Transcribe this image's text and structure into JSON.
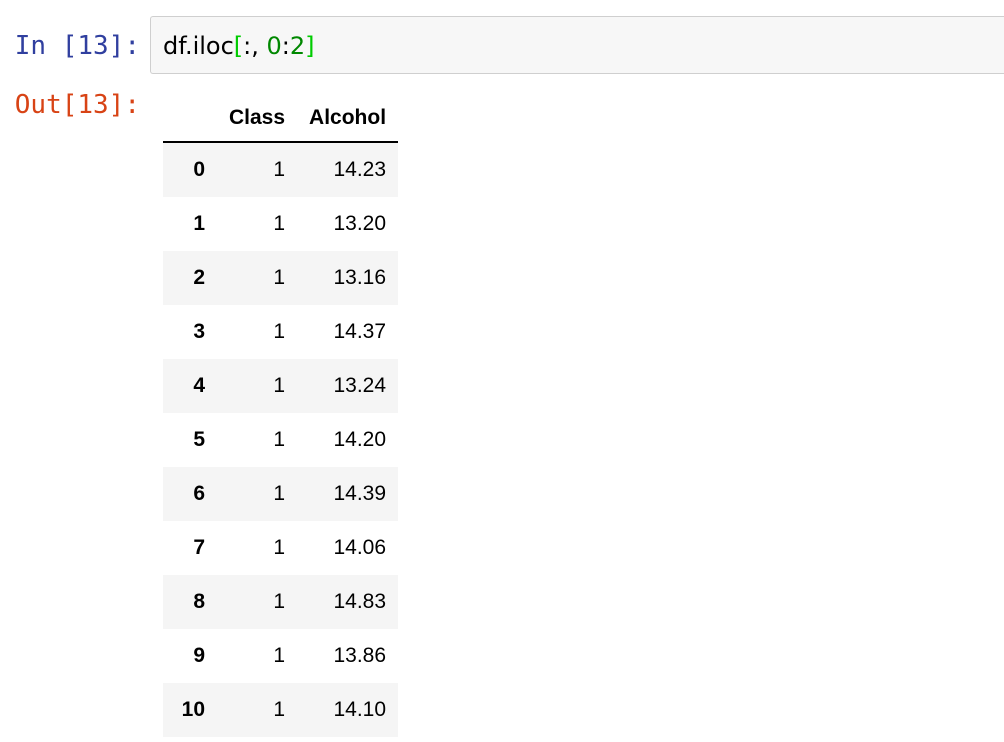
{
  "cell": {
    "in_prompt": "In [13]:",
    "out_prompt": "Out[13]:",
    "code": {
      "prefix": "df.iloc",
      "open_bracket": "[",
      "middle": ":, ",
      "start": "0",
      "colon": ":",
      "stop": "2",
      "close_bracket": "]"
    }
  },
  "output": {
    "columns": [
      "",
      "Class",
      "Alcohol"
    ],
    "rows": [
      {
        "index": "0",
        "class": "1",
        "alcohol": "14.23"
      },
      {
        "index": "1",
        "class": "1",
        "alcohol": "13.20"
      },
      {
        "index": "2",
        "class": "1",
        "alcohol": "13.16"
      },
      {
        "index": "3",
        "class": "1",
        "alcohol": "14.37"
      },
      {
        "index": "4",
        "class": "1",
        "alcohol": "13.24"
      },
      {
        "index": "5",
        "class": "1",
        "alcohol": "14.20"
      },
      {
        "index": "6",
        "class": "1",
        "alcohol": "14.39"
      },
      {
        "index": "7",
        "class": "1",
        "alcohol": "14.06"
      },
      {
        "index": "8",
        "class": "1",
        "alcohol": "14.83"
      },
      {
        "index": "9",
        "class": "1",
        "alcohol": "13.86"
      },
      {
        "index": "10",
        "class": "1",
        "alcohol": "14.10"
      }
    ]
  },
  "colors": {
    "in_prompt": "#303f9f",
    "out_prompt": "#d84315",
    "number_token": "#008800",
    "bracket_token": "#00cc00",
    "input_background": "#f7f7f7",
    "striped_row": "#f5f5f5"
  }
}
